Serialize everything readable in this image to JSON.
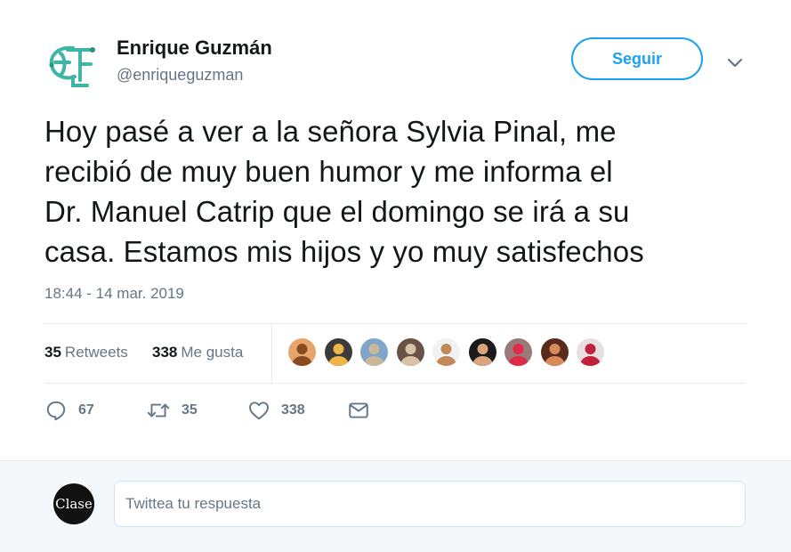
{
  "user": {
    "name": "Enrique Guzmán",
    "handle": "@enriqueguzman",
    "avatar_icon": "eg-monogram-logo-icon",
    "avatar_color": "#3fb5a8"
  },
  "follow_button": {
    "label": "Seguir"
  },
  "menu": {
    "icon": "chevron-down-icon"
  },
  "tweet": {
    "lines": [
      "Hoy pasé a ver a la señora Sylvia Pinal, me",
      "recibió de muy buen humor y me informa el",
      "Dr. Manuel Catrip que el domingo se irá a su",
      "casa. Estamos mis hijos y yo muy satisfechos"
    ],
    "timestamp": "18:44 - 14 mar. 2019"
  },
  "stats": {
    "retweets_count": "35",
    "retweets_label": "Retweets",
    "likes_count": "338",
    "likes_label": "Me gusta"
  },
  "likers": [
    {
      "icon": "liker-avatar-icon",
      "bg": "#e7a56b",
      "fg": "#8a4a1f"
    },
    {
      "icon": "liker-avatar-icon",
      "bg": "#3b3b3b",
      "fg": "#f0b54a"
    },
    {
      "icon": "liker-avatar-icon",
      "bg": "#7fa6c9",
      "fg": "#c9b79a"
    },
    {
      "icon": "liker-avatar-icon",
      "bg": "#6b5145",
      "fg": "#d9c3a8"
    },
    {
      "icon": "liker-avatar-icon",
      "bg": "#f2f2f2",
      "fg": "#c08a5a"
    },
    {
      "icon": "liker-avatar-icon",
      "bg": "#1a1a1a",
      "fg": "#d9a37e"
    },
    {
      "icon": "liker-avatar-icon",
      "bg": "#9a7a78",
      "fg": "#e02a4a"
    },
    {
      "icon": "liker-avatar-icon",
      "bg": "#5a2a1e",
      "fg": "#d88a5a"
    },
    {
      "icon": "liker-avatar-icon",
      "bg": "#e8e0e0",
      "fg": "#c0203a"
    }
  ],
  "actions": {
    "reply": {
      "icon": "reply-icon",
      "count": "67"
    },
    "retweet": {
      "icon": "retweet-icon",
      "count": "35"
    },
    "like": {
      "icon": "heart-icon",
      "count": "338"
    },
    "message": {
      "icon": "envelope-icon"
    }
  },
  "reply_bar": {
    "avatar_text": "Clase",
    "placeholder": "Twittea tu respuesta"
  }
}
